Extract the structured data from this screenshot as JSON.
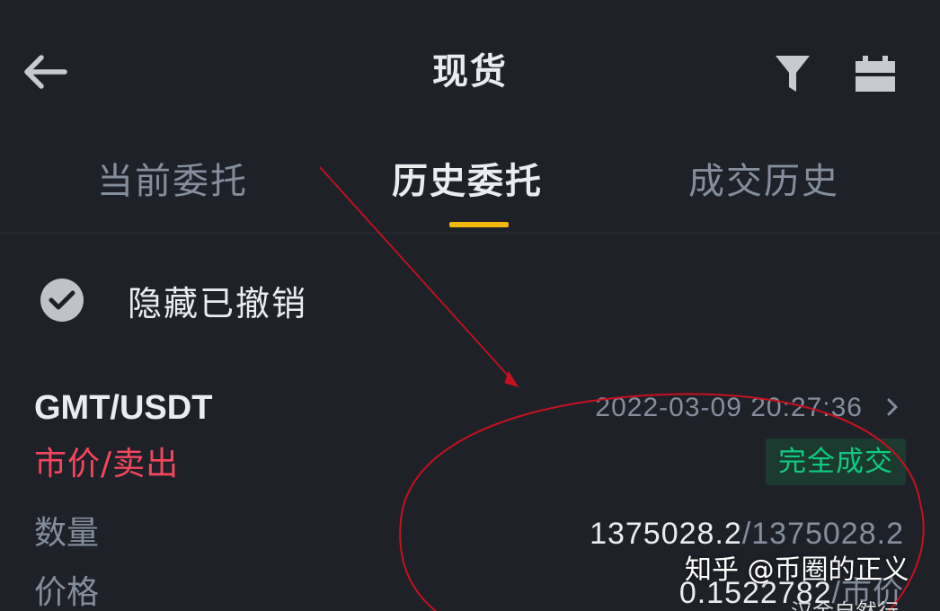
{
  "header": {
    "title": "现货",
    "icons": {
      "back": "arrow-left-icon",
      "filter": "filter-icon",
      "calendar": "calendar-icon"
    }
  },
  "tabs": [
    {
      "label": "当前委托",
      "active": false
    },
    {
      "label": "历史委托",
      "active": true
    },
    {
      "label": "成交历史",
      "active": false
    }
  ],
  "filter": {
    "hide_cancelled_label": "隐藏已撤销",
    "checked": true
  },
  "order": {
    "pair": "GMT/USDT",
    "timestamp": "2022-03-09 20:27:36",
    "type": "市价/卖出",
    "status": "完全成交",
    "quantity_label": "数量",
    "quantity_filled": "1375028.2",
    "quantity_sep": "/",
    "quantity_total": "1375028.2",
    "price_label": "价格",
    "price_value": "0.1522782",
    "price_sep": "/",
    "price_unit": "市价"
  },
  "watermark": {
    "text": "知乎 @币圈的正义",
    "text2": "汉金自然行"
  },
  "colors": {
    "background": "#1f2129",
    "accent": "#f0b90b",
    "sell": "#f6465d",
    "success": "#0ecb81",
    "annotation": "#c8101e"
  }
}
